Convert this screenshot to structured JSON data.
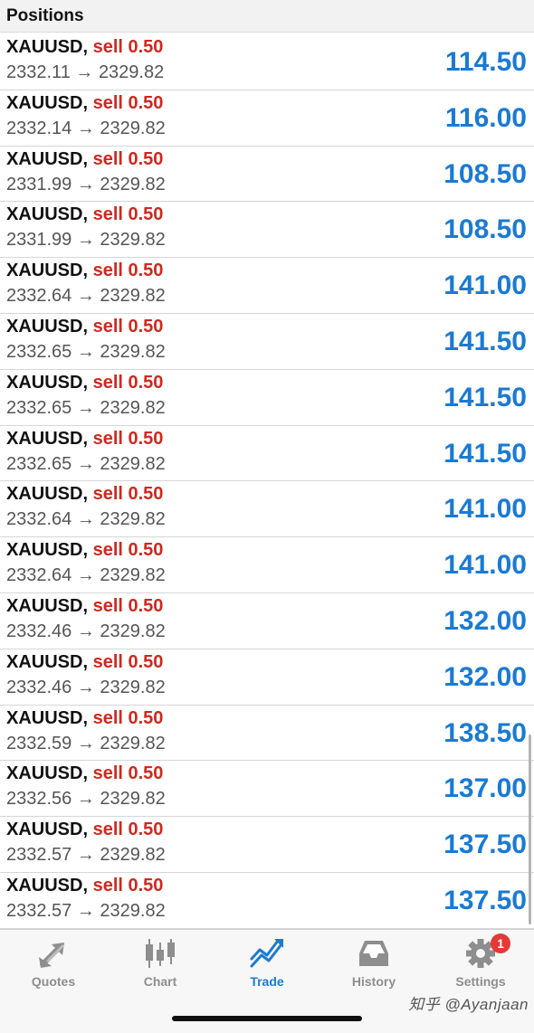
{
  "header": {
    "title": "Positions"
  },
  "positions": [
    {
      "symbol": "XAUUSD,",
      "side": "sell 0.50",
      "open_price": "2332.11",
      "arrow": "→",
      "current_price": "2329.82",
      "profit": "114.50"
    },
    {
      "symbol": "XAUUSD,",
      "side": "sell 0.50",
      "open_price": "2332.14",
      "arrow": "→",
      "current_price": "2329.82",
      "profit": "116.00"
    },
    {
      "symbol": "XAUUSD,",
      "side": "sell 0.50",
      "open_price": "2331.99",
      "arrow": "→",
      "current_price": "2329.82",
      "profit": "108.50"
    },
    {
      "symbol": "XAUUSD,",
      "side": "sell 0.50",
      "open_price": "2331.99",
      "arrow": "→",
      "current_price": "2329.82",
      "profit": "108.50"
    },
    {
      "symbol": "XAUUSD,",
      "side": "sell 0.50",
      "open_price": "2332.64",
      "arrow": "→",
      "current_price": "2329.82",
      "profit": "141.00"
    },
    {
      "symbol": "XAUUSD,",
      "side": "sell 0.50",
      "open_price": "2332.65",
      "arrow": "→",
      "current_price": "2329.82",
      "profit": "141.50"
    },
    {
      "symbol": "XAUUSD,",
      "side": "sell 0.50",
      "open_price": "2332.65",
      "arrow": "→",
      "current_price": "2329.82",
      "profit": "141.50"
    },
    {
      "symbol": "XAUUSD,",
      "side": "sell 0.50",
      "open_price": "2332.65",
      "arrow": "→",
      "current_price": "2329.82",
      "profit": "141.50"
    },
    {
      "symbol": "XAUUSD,",
      "side": "sell 0.50",
      "open_price": "2332.64",
      "arrow": "→",
      "current_price": "2329.82",
      "profit": "141.00"
    },
    {
      "symbol": "XAUUSD,",
      "side": "sell 0.50",
      "open_price": "2332.64",
      "arrow": "→",
      "current_price": "2329.82",
      "profit": "141.00"
    },
    {
      "symbol": "XAUUSD,",
      "side": "sell 0.50",
      "open_price": "2332.46",
      "arrow": "→",
      "current_price": "2329.82",
      "profit": "132.00"
    },
    {
      "symbol": "XAUUSD,",
      "side": "sell 0.50",
      "open_price": "2332.46",
      "arrow": "→",
      "current_price": "2329.82",
      "profit": "132.00"
    },
    {
      "symbol": "XAUUSD,",
      "side": "sell 0.50",
      "open_price": "2332.59",
      "arrow": "→",
      "current_price": "2329.82",
      "profit": "138.50"
    },
    {
      "symbol": "XAUUSD,",
      "side": "sell 0.50",
      "open_price": "2332.56",
      "arrow": "→",
      "current_price": "2329.82",
      "profit": "137.00"
    },
    {
      "symbol": "XAUUSD,",
      "side": "sell 0.50",
      "open_price": "2332.57",
      "arrow": "→",
      "current_price": "2329.82",
      "profit": "137.50"
    },
    {
      "symbol": "XAUUSD,",
      "side": "sell 0.50",
      "open_price": "2332.57",
      "arrow": "→",
      "current_price": "2329.82",
      "profit": "137.50"
    }
  ],
  "tabbar": {
    "tabs": [
      {
        "key": "quotes",
        "label": "Quotes",
        "icon": "quotes-arrows-icon",
        "active": false
      },
      {
        "key": "chart",
        "label": "Chart",
        "icon": "candlestick-chart-icon",
        "active": false
      },
      {
        "key": "trade",
        "label": "Trade",
        "icon": "trade-trend-icon",
        "active": true
      },
      {
        "key": "history",
        "label": "History",
        "icon": "inbox-tray-icon",
        "active": false
      },
      {
        "key": "settings",
        "label": "Settings",
        "icon": "gear-icon",
        "active": false,
        "badge": "1"
      }
    ]
  },
  "watermark": {
    "text": "知乎 @Ayanjaan"
  },
  "colors": {
    "profit": "#1a7ad4",
    "sell": "#d0281e",
    "tab_inactive": "#8e8e8e",
    "tab_active": "#1a7ad4",
    "badge": "#e53935"
  }
}
